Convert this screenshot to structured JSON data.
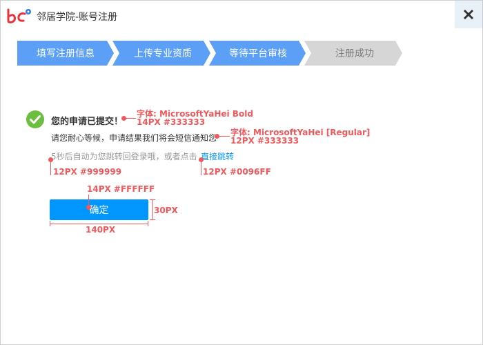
{
  "window": {
    "title": "邻居学院-账号注册",
    "logo_text": "bc"
  },
  "steps": [
    {
      "label": "填写注册信息",
      "state": "active"
    },
    {
      "label": "上传专业资质",
      "state": "active"
    },
    {
      "label": "等待平台审核",
      "state": "active"
    },
    {
      "label": "注册成功",
      "state": "inactive"
    }
  ],
  "content": {
    "headline": "您的申请已提交！",
    "body": "请您耐心等候，申请结果我们将会短信通知您",
    "countdown": "5秒后自动为您跳转回登录哦，或者点击",
    "redirect_link": "直接跳转",
    "confirm_button": "确定"
  },
  "annotations": {
    "headline_font": "字体: MicrosoftYaHei Bold",
    "headline_spec": "14PX #333333",
    "body_font": "字体: MicrosoftYaHei [Regular]",
    "body_spec": "12PX #333333",
    "countdown_spec": "12PX #999999",
    "link_spec": "12PX #0096FF",
    "button_text_spec": "14PX #FFFFFF",
    "button_height": "30PX",
    "button_width": "140PX"
  },
  "colors": {
    "accent": "#0096FF",
    "step_active": "#5B9FF7",
    "step_inactive": "#D6D6D6",
    "annotation": "#F0585C",
    "success_green": "#6CBE3E"
  },
  "icons": [
    "logo-icon",
    "close-icon",
    "check-circle-icon"
  ]
}
